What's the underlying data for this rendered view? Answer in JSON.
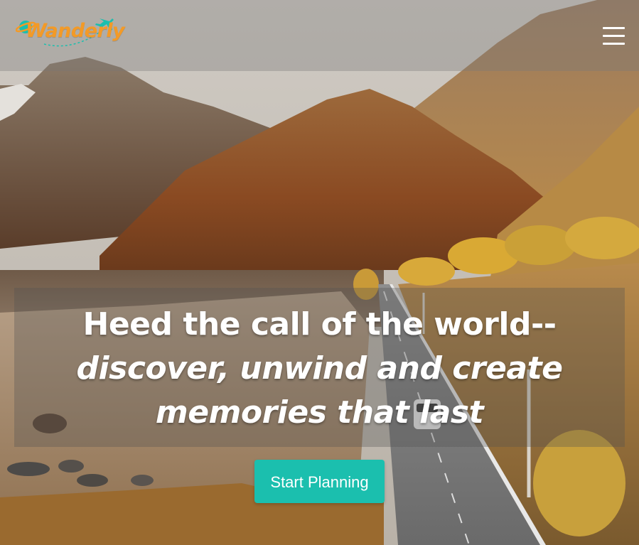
{
  "brand": {
    "name": "Wanderly",
    "logo_icon": "planet-airplane-icon",
    "color": "#f39a27",
    "accent": "#1bbfae"
  },
  "header": {
    "menu_icon": "hamburger-menu-icon"
  },
  "hero": {
    "headline_line1": "Heed the call of the world--",
    "headline_line2": "discover, unwind and create",
    "headline_line3": "memories that last",
    "background": "mountain-road-lake-photo",
    "cta_label": "Start Planning",
    "cta_color": "#1bbfae"
  }
}
